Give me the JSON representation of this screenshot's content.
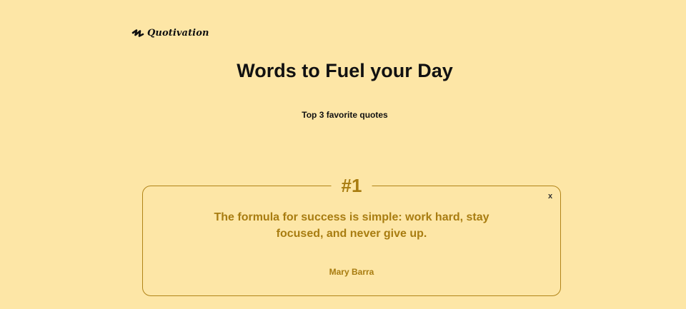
{
  "brand": {
    "name": "Quotivation",
    "icon": "logo-squiggle-icon"
  },
  "header": {
    "title": "Words to Fuel your Day",
    "subtitle": "Top 3 favorite quotes"
  },
  "quotes": [
    {
      "rank": "#1",
      "text": "The formula for success is simple: work hard, stay focused, and never give up.",
      "author": "Mary Barra",
      "close_label": "x"
    }
  ],
  "colors": {
    "background": "#fde6a6",
    "accent": "#a87c10",
    "text": "#111111"
  }
}
